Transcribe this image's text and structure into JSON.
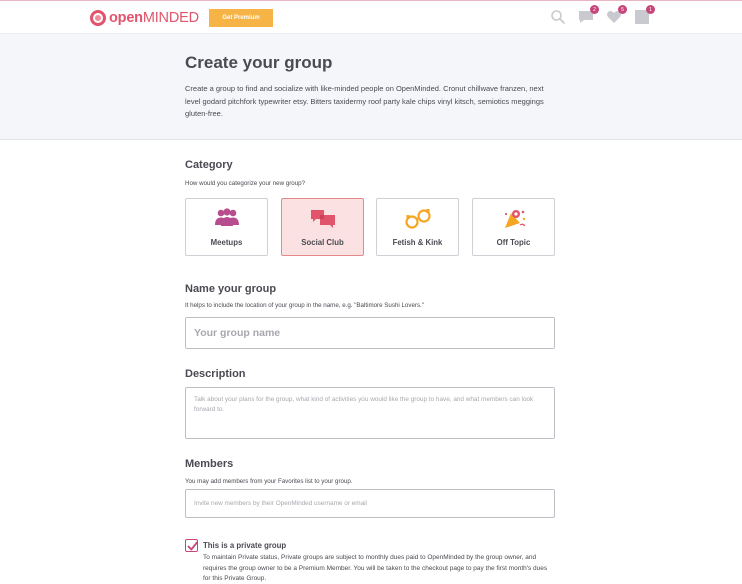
{
  "header": {
    "logo_open": "open",
    "logo_minded": "MINDED",
    "premium_button": "Get Premium",
    "icons": [
      {
        "name": "search-icon",
        "badge": ""
      },
      {
        "name": "messages-icon",
        "badge": "2"
      },
      {
        "name": "favorites-heart-icon",
        "badge": "5"
      },
      {
        "name": "notifications-icon",
        "badge": "1"
      }
    ]
  },
  "hero": {
    "title": "Create your group",
    "description": "Create a group to find and socialize with like-minded people on OpenMinded. Cronut chillwave franzen, next level godard pitchfork typewriter etsy. Bitters taxidermy roof party kale chips vinyl kitsch, semiotics meggings gluten-free."
  },
  "category": {
    "title": "Category",
    "subtitle": "How would you categorize your new group?",
    "options": [
      {
        "label": "Meetups",
        "icon": "people-group-icon",
        "selected": false
      },
      {
        "label": "Social Club",
        "icon": "chat-bubbles-icon",
        "selected": true
      },
      {
        "label": "Fetish & Kink",
        "icon": "handcuffs-icon",
        "selected": false
      },
      {
        "label": "Off Topic",
        "icon": "party-icon",
        "selected": false
      }
    ]
  },
  "name": {
    "title": "Name your group",
    "subtitle": "It helps to include the location of your group in the name, e.g. \"Baltimore Sushi Lovers.\"",
    "placeholder": "Your group name"
  },
  "description": {
    "title": "Description",
    "placeholder": "Talk about your plans for the group, what kind of activities you would like the group to have, and what members can look forward to."
  },
  "members": {
    "title": "Members",
    "subtitle": "You may add members from your Favorites list to your group.",
    "placeholder": "Invite new members by their OpenMinded username or email"
  },
  "private": {
    "checked": true,
    "label": "This is a private group",
    "description": "To maintain Private status, Private groups are subject to monthly dues paid to OpenMinded by the group owner, and requires the group owner to be a Premium Member. You will be taken to the checkout page to pay the first month's dues for this Private Group."
  },
  "colors": {
    "brand": "#e2546b",
    "accent": "#c7467a",
    "premium": "#f5b445",
    "selected_bg": "#fbe1e1",
    "selected_border": "#e58a8a",
    "icon_orange": "#f5a623",
    "hero_bg": "#f5f6fa"
  }
}
